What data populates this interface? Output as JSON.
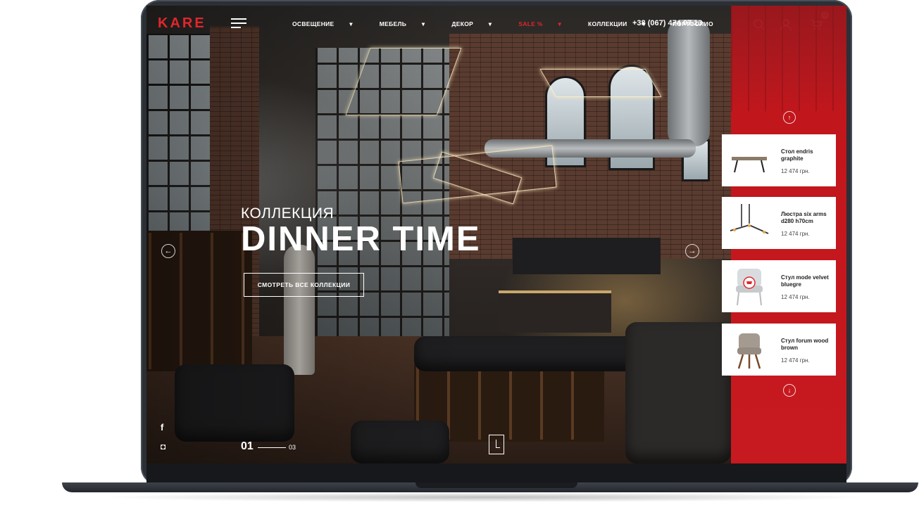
{
  "header": {
    "logo": "KARE",
    "nav": [
      "ОСВЕЩЕНИЕ",
      "МЕБЕЛЬ",
      "ДЕКОР",
      "SALE %",
      "КОЛЛЕКЦИИ",
      "ПОРТФОЛИО"
    ],
    "nav_dropdown_arrow": "▾",
    "phone": "+38 (067) 474 07 13",
    "cart_count": "12"
  },
  "hero": {
    "kicker": "КОЛЛЕКЦИЯ",
    "title": "DINNER TIME",
    "button": "СМОТРЕТЬ  ВСЕ КОЛЛЕКЦИИ",
    "prev_arrow": "←",
    "next_arrow": "→",
    "current_slide": "01",
    "total_slides": "03"
  },
  "social": {
    "facebook": "f",
    "instagram": "◘"
  },
  "products": [
    {
      "name": "Стол endris graphite",
      "price": "12 474 грн."
    },
    {
      "name": "Люстра six arms d280 h70cm",
      "price": "12 474 грн."
    },
    {
      "name": "Стул mode velvet bluegre",
      "price": "12 474 грн."
    },
    {
      "name": "Стул forum wood brown",
      "price": "12 474 грн."
    }
  ],
  "panel": {
    "up_arrow": "↑",
    "down_arrow": "↓"
  },
  "colors": {
    "accent": "#e0262c",
    "panel": "#c71a20"
  },
  "icons": [
    "search-icon",
    "user-icon",
    "cart-icon",
    "menu-icon",
    "facebook-icon",
    "instagram-icon",
    "cart-add-icon"
  ]
}
